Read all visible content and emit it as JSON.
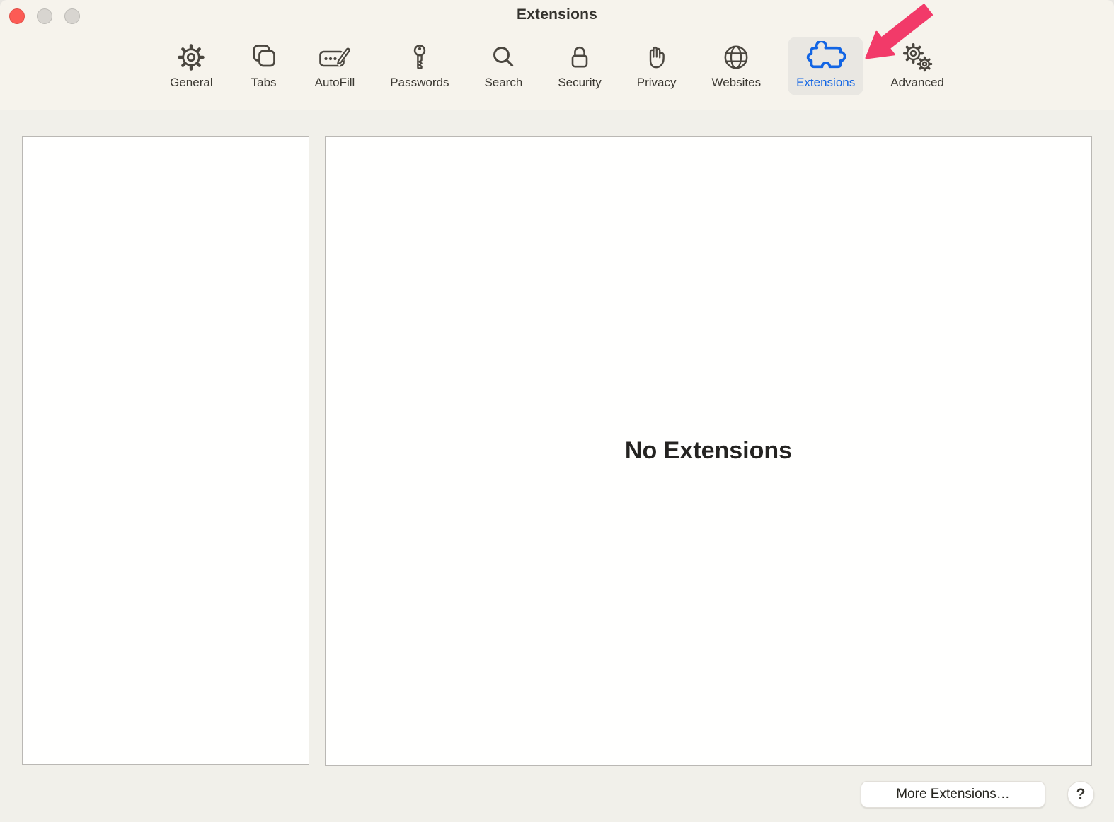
{
  "window": {
    "title": "Extensions",
    "traffic_lights": [
      "close",
      "minimize",
      "zoom"
    ]
  },
  "toolbar": {
    "items": [
      {
        "label": "General",
        "icon": "gear-icon",
        "selected": false
      },
      {
        "label": "Tabs",
        "icon": "overlapping-squares-icon",
        "selected": false
      },
      {
        "label": "AutoFill",
        "icon": "card-pencil-icon",
        "selected": false
      },
      {
        "label": "Passwords",
        "icon": "key-icon",
        "selected": false
      },
      {
        "label": "Search",
        "icon": "magnifier-icon",
        "selected": false
      },
      {
        "label": "Security",
        "icon": "lock-icon",
        "selected": false
      },
      {
        "label": "Privacy",
        "icon": "hand-icon",
        "selected": false
      },
      {
        "label": "Websites",
        "icon": "globe-icon",
        "selected": false
      },
      {
        "label": "Extensions",
        "icon": "puzzle-piece-icon",
        "selected": true
      },
      {
        "label": "Advanced",
        "icon": "double-gear-icon",
        "selected": false
      }
    ]
  },
  "main": {
    "empty_state": "No Extensions"
  },
  "footer": {
    "more_extensions_label": "More Extensions…",
    "help_label": "?"
  },
  "annotation": {
    "type": "arrow",
    "target": "Extensions tab",
    "color": "#f23a69"
  },
  "colors": {
    "accent_blue": "#1265e4",
    "toolbar_bg": "#f6f3ec",
    "content_bg": "#f1f0ea",
    "selected_tab_bg": "#e9e7e2",
    "close_red": "#fc5b55",
    "panel_border": "#bab8b4"
  }
}
